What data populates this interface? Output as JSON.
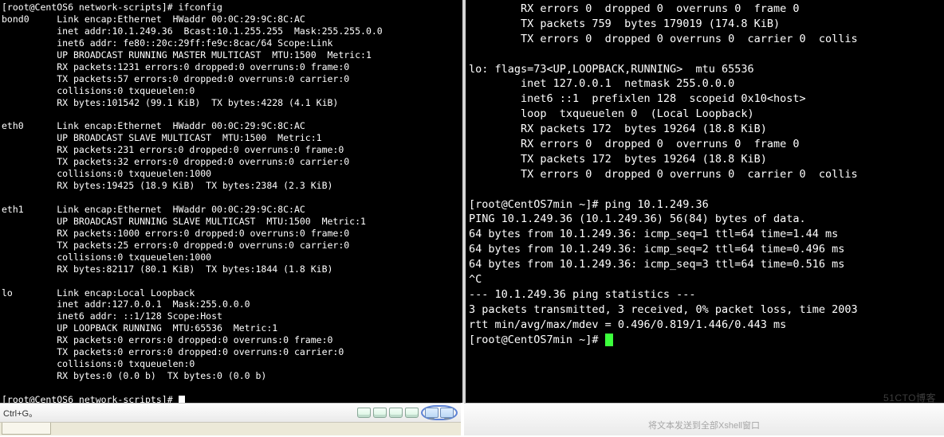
{
  "left": {
    "text": "[root@CentOS6 network-scripts]# ifconfig\nbond0     Link encap:Ethernet  HWaddr 00:0C:29:9C:8C:AC\n          inet addr:10.1.249.36  Bcast:10.1.255.255  Mask:255.255.0.0\n          inet6 addr: fe80::20c:29ff:fe9c:8cac/64 Scope:Link\n          UP BROADCAST RUNNING MASTER MULTICAST  MTU:1500  Metric:1\n          RX packets:1231 errors:0 dropped:0 overruns:0 frame:0\n          TX packets:57 errors:0 dropped:0 overruns:0 carrier:0\n          collisions:0 txqueuelen:0\n          RX bytes:101542 (99.1 KiB)  TX bytes:4228 (4.1 KiB)\n\neth0      Link encap:Ethernet  HWaddr 00:0C:29:9C:8C:AC\n          UP BROADCAST SLAVE MULTICAST  MTU:1500  Metric:1\n          RX packets:231 errors:0 dropped:0 overruns:0 frame:0\n          TX packets:32 errors:0 dropped:0 overruns:0 carrier:0\n          collisions:0 txqueuelen:1000\n          RX bytes:19425 (18.9 KiB)  TX bytes:2384 (2.3 KiB)\n\neth1      Link encap:Ethernet  HWaddr 00:0C:29:9C:8C:AC\n          UP BROADCAST RUNNING SLAVE MULTICAST  MTU:1500  Metric:1\n          RX packets:1000 errors:0 dropped:0 overruns:0 frame:0\n          TX packets:25 errors:0 dropped:0 overruns:0 carrier:0\n          collisions:0 txqueuelen:1000\n          RX bytes:82117 (80.1 KiB)  TX bytes:1844 (1.8 KiB)\n\nlo        Link encap:Local Loopback\n          inet addr:127.0.0.1  Mask:255.0.0.0\n          inet6 addr: ::1/128 Scope:Host\n          UP LOOPBACK RUNNING  MTU:65536  Metric:1\n          RX packets:0 errors:0 dropped:0 overruns:0 frame:0\n          TX packets:0 errors:0 dropped:0 overruns:0 carrier:0\n          collisions:0 txqueuelen:0\n          RX bytes:0 (0.0 b)  TX bytes:0 (0.0 b)\n\n[root@CentOS6 network-scripts]# "
  },
  "right": {
    "text": "        RX errors 0  dropped 0  overruns 0  frame 0\n        TX packets 759  bytes 179019 (174.8 KiB)\n        TX errors 0  dropped 0 overruns 0  carrier 0  collis\n\nlo: flags=73<UP,LOOPBACK,RUNNING>  mtu 65536\n        inet 127.0.0.1  netmask 255.0.0.0\n        inet6 ::1  prefixlen 128  scopeid 0x10<host>\n        loop  txqueuelen 0  (Local Loopback)\n        RX packets 172  bytes 19264 (18.8 KiB)\n        RX errors 0  dropped 0  overruns 0  frame 0\n        TX packets 172  bytes 19264 (18.8 KiB)\n        TX errors 0  dropped 0 overruns 0  carrier 0  collis\n\n[root@CentOS7min ~]# ping 10.1.249.36\nPING 10.1.249.36 (10.1.249.36) 56(84) bytes of data.\n64 bytes from 10.1.249.36: icmp_seq=1 ttl=64 time=1.44 ms\n64 bytes from 10.1.249.36: icmp_seq=2 ttl=64 time=0.496 ms\n64 bytes from 10.1.249.36: icmp_seq=3 ttl=64 time=0.516 ms\n^C\n--- 10.1.249.36 ping statistics ---\n3 packets transmitted, 3 received, 0% packet loss, time 2003\nrtt min/avg/max/mdev = 0.496/0.819/1.446/0.443 ms\n[root@CentOS7min ~]# "
  },
  "status": {
    "hint": "Ctrl+G。",
    "broadcast": "将文本发送到全部Xshell窗口",
    "watermark": "51CTO博客"
  }
}
